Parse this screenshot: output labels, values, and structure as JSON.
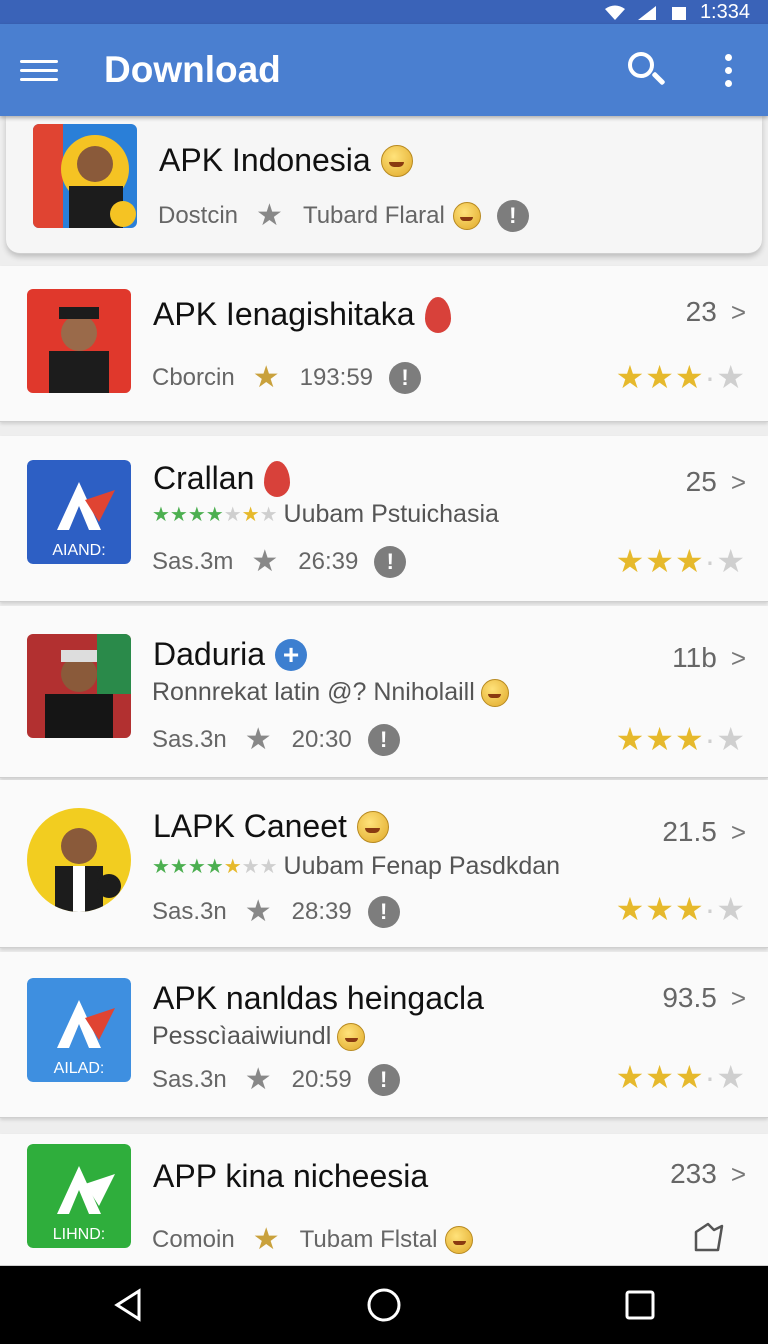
{
  "status_bar": {
    "time": "1:334"
  },
  "app_bar": {
    "title": "Download"
  },
  "apps": [
    {
      "title": "APK Indonesia",
      "publisher": "Dostcin",
      "meta": "Tubard Flaral",
      "count": "",
      "thumb": "person-colorful",
      "badge": "emoji"
    },
    {
      "title": "APK Ienagishitaka",
      "publisher": "Cborcin",
      "meta": "193:59",
      "count": "23",
      "thumb": "officer-red",
      "badge": "drop"
    },
    {
      "title": "Crallan",
      "subtitle": "Uubam Pstuichasia",
      "publisher": "Sas.3m",
      "meta": "26:39",
      "count": "25",
      "thumb": "logo-blue",
      "logo_text": "AIAND:",
      "badge": "drop"
    },
    {
      "title": "Daduria",
      "subtitle": "Ronnrekat latin @? Nniholaill",
      "publisher": "Sas.3n",
      "meta": "20:30",
      "count": "11b",
      "thumb": "person-dark",
      "badge": "plus"
    },
    {
      "title": "LAPK Caneet",
      "subtitle": "Uubam Fenap Pasdkdan",
      "publisher": "Sas.3n",
      "meta": "28:39",
      "count": "21.5",
      "thumb": "person-yellow",
      "badge": "emoji"
    },
    {
      "title": "APK nanldas heingacla",
      "subtitle": "Pesscìaaiwiundl",
      "publisher": "Sas.3n",
      "meta": "20:59",
      "count": "93.5",
      "thumb": "logo-lightblue",
      "logo_text": "AILAD:",
      "badge": "none"
    },
    {
      "title": "APP kina nicheesia",
      "publisher": "Comoin",
      "meta": "Tubam Flstal",
      "count": "233",
      "thumb": "logo-green",
      "logo_text": "LIHND:",
      "badge": "none"
    }
  ],
  "colors": {
    "app_bar": "#4a7fd0",
    "status_bar": "#3a63b8",
    "star": "#e6b92c"
  }
}
